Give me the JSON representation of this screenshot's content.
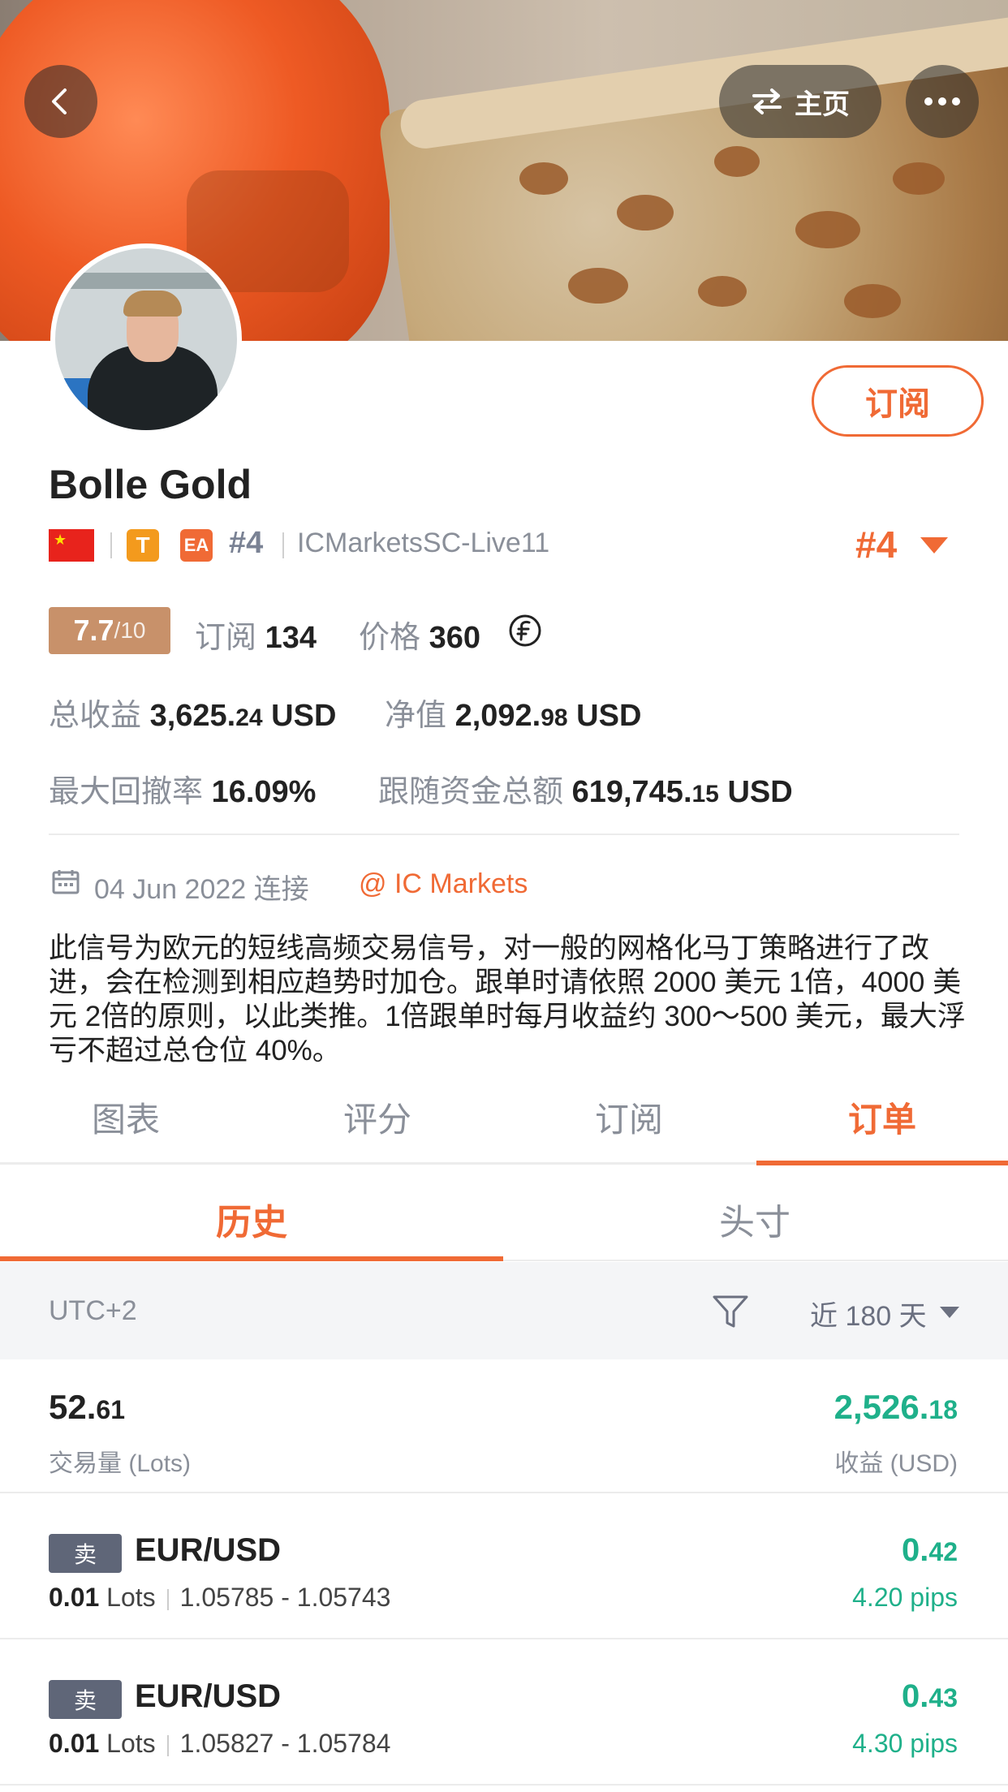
{
  "header": {
    "home_label": "主页",
    "back_icon": "chevron-left-icon",
    "swap_icon": "swap-arrows-icon",
    "more_icon": "more-horizontal-icon"
  },
  "profile": {
    "subscribe_label": "订阅",
    "name": "Bolle Gold",
    "tag_t": "T",
    "tag_ea": "EA",
    "rank_small": "#4",
    "server": "ICMarketsSC-Live11",
    "rank_big": "#4"
  },
  "stats": {
    "score": "7.7",
    "score_den": "/10",
    "subscribers_label": "订阅",
    "subscribers": "134",
    "price_label": "价格",
    "price": "360",
    "total_profit_label": "总收益",
    "total_profit_int": "3,625.",
    "total_profit_dec": "24",
    "total_profit_unit": "USD",
    "equity_label": "净值",
    "equity_int": "2,092.",
    "equity_dec": "98",
    "equity_unit": "USD",
    "max_drawdown_label": "最大回撤率",
    "max_drawdown": "16.09%",
    "follow_funds_label": "跟随资金总额",
    "follow_funds_int": "619,745.",
    "follow_funds_dec": "15",
    "follow_funds_unit": "USD"
  },
  "connection": {
    "date_text": "04 Jun 2022 连接",
    "broker": "@ IC Markets"
  },
  "description": "此信号为欧元的短线高频交易信号，对一般的网格化马丁策略进行了改进，会在检测到相应趋势时加仓。跟单时请依照 2000 美元 1倍，4000 美元 2倍的原则，以此类推。1倍跟单时每月收益约 300～500 美元，最大浮亏不超过总仓位 40%。",
  "tabs": [
    "图表",
    "评分",
    "订阅",
    "订单"
  ],
  "subtabs": [
    "历史",
    "头寸"
  ],
  "filter": {
    "timezone": "UTC+2",
    "range": "近 180 天"
  },
  "summary": {
    "volume_int": "52.",
    "volume_dec": "61",
    "volume_label": "交易量 (Lots)",
    "profit_int": "2,526.",
    "profit_dec": "18",
    "profit_label": "收益 (USD)"
  },
  "orders": [
    {
      "side": "卖",
      "symbol": "EUR/USD",
      "lots": "0.01",
      "lots_unit": "Lots",
      "prices": "1.05785 - 1.05743",
      "pl_int": "0.",
      "pl_dec": "42",
      "pips": "4.20 pips"
    },
    {
      "side": "卖",
      "symbol": "EUR/USD",
      "lots": "0.01",
      "lots_unit": "Lots",
      "prices": "1.05827 - 1.05784",
      "pl_int": "0.",
      "pl_dec": "43",
      "pips": "4.30 pips"
    }
  ]
}
